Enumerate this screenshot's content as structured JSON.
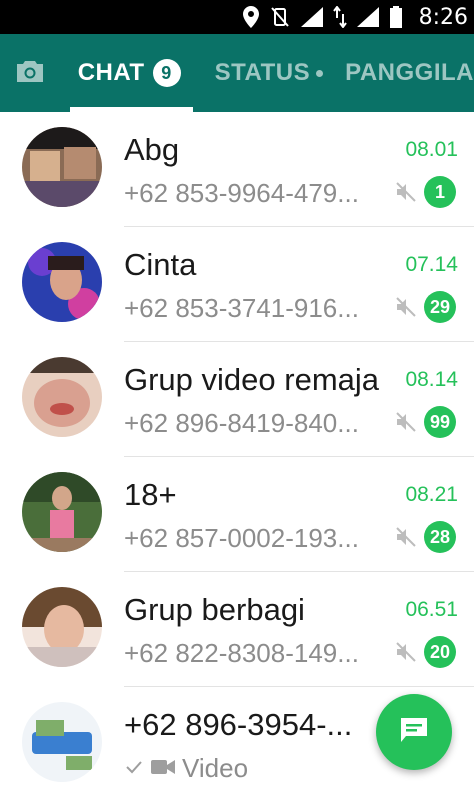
{
  "status_bar": {
    "time": "8:26",
    "icons": [
      "location-icon",
      "vibrate-off-icon",
      "signal-icon",
      "data-transfer-icon",
      "signal-2-icon",
      "battery-icon"
    ]
  },
  "tabs": {
    "camera_icon": "camera-icon",
    "chat_label": "CHAT",
    "chat_badge": "9",
    "status_label": "STATUS",
    "calls_label": "PANGGILA"
  },
  "chats": [
    {
      "name": "Abg",
      "time": "08.01",
      "preview": "+62 853-9964-479...",
      "unread": "1",
      "muted": true
    },
    {
      "name": "Cinta",
      "time": "07.14",
      "preview": "+62 853-3741-916...",
      "unread": "29",
      "muted": true
    },
    {
      "name": "Grup video remaja",
      "time": "08.14",
      "preview": "+62 896-8419-840...",
      "unread": "99",
      "muted": true
    },
    {
      "name": "18+",
      "time": "08.21",
      "preview": "+62 857-0002-193...",
      "unread": "28",
      "muted": true
    },
    {
      "name": "Grup berbagi",
      "time": "06.51",
      "preview": "+62 822-8308-149...",
      "unread": "20",
      "muted": true
    },
    {
      "name": "+62 896-3954-...",
      "preview": "Video",
      "preview_icons": [
        "check-icon",
        "videocam-icon"
      ]
    }
  ],
  "fab": {
    "icon": "new-chat-icon"
  },
  "colors": {
    "appbar": "#0a7267",
    "accent_green": "#25c15a",
    "text_secondary": "#8c8c8c"
  }
}
